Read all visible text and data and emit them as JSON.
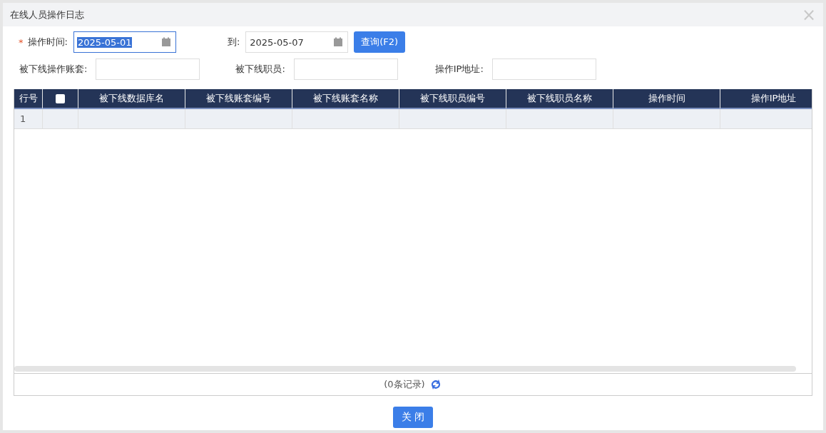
{
  "window": {
    "title": "在线人员操作日志",
    "close": "×"
  },
  "filters": {
    "row1": [
      {
        "kind": "date",
        "required_mark": "*",
        "label": "操作时间:",
        "value": "2025-05-01",
        "focused": true
      },
      {
        "kind": "date",
        "label": "到:",
        "value": "2025-05-07",
        "focused": false
      },
      {
        "kind": "button",
        "label": "查询(F2)"
      }
    ],
    "row2": [
      {
        "kind": "text",
        "label": "被下线操作账套:"
      },
      {
        "kind": "text",
        "label": "被下线职员:"
      },
      {
        "kind": "text",
        "label": "操作IP地址:"
      }
    ]
  },
  "table": {
    "select_all": {
      "checked": false
    },
    "columns": [
      "行号",
      "",
      "被下线数据库名",
      "被下线账套编号",
      "被下线账套名称",
      "被下线职员编号",
      "被下线职员名称",
      "操作时间",
      "操作IP地址"
    ],
    "rows": [
      {
        "row_number": "1"
      }
    ]
  },
  "footer": {
    "record_count": "(0条记录)"
  },
  "buttons": [
    "关 闭"
  ]
}
